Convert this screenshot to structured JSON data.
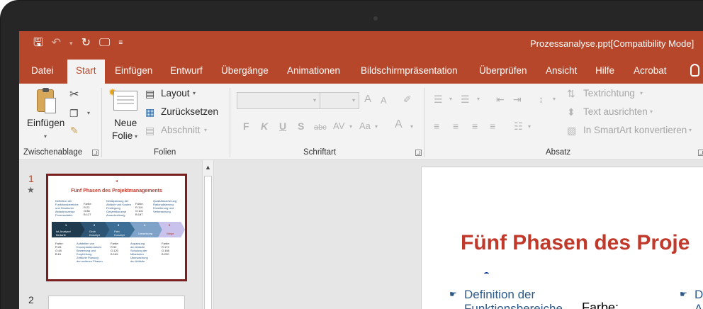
{
  "window": {
    "title": "Prozessanalyse.ppt[Compatibility Mode]"
  },
  "tabs": [
    "Datei",
    "Start",
    "Einfügen",
    "Entwurf",
    "Übergänge",
    "Animationen",
    "Bildschirmpräsentation",
    "Überprüfen",
    "Ansicht",
    "Hilfe",
    "Acrobat"
  ],
  "active_tab": "Start",
  "ribbon": {
    "clipboard": {
      "paste_label": "Einfügen",
      "group_label": "Zwischenablage"
    },
    "slides": {
      "new_slide_line1": "Neue",
      "new_slide_line2": "Folie",
      "layout_label": "Layout",
      "reset_label": "Zurücksetzen",
      "section_label": "Abschnitt",
      "group_label": "Folien"
    },
    "font": {
      "group_label": "Schriftart",
      "bold": "F",
      "italic": "K",
      "underline": "U",
      "shadow": "S",
      "strike": "abc",
      "spacing": "AV",
      "case": "Aa",
      "color": "A",
      "grow": "A",
      "shrink": "A"
    },
    "paragraph": {
      "group_label": "Absatz",
      "text_direction": "Textrichtung",
      "align_text": "Text ausrichten",
      "smartart": "In SmartArt konvertieren"
    }
  },
  "thumbnails": {
    "slide1_number": "1",
    "slide2_number": "2",
    "slide1": {
      "title": "Fünf Phasen des Projektmanagements",
      "col1": "Definition der\nFunktionsbereiche\nund Strukturen\nAblaufprozesse\nProzessdaten",
      "col1b": "Farbe:\nR:22\nG:86\nB:127",
      "col2": "Detailplanung der\nAbläufe und Kosten\nFestlegung\nGesamtkonzept\nAusschreibung",
      "col2b": "Farbe:\nR:119\nG:101\nB:187",
      "col3": "Qualitätssicherung\nRationalisierung\nErweiterung und\nVerbesserung",
      "chevrons": [
        "1",
        "2",
        "3",
        "4",
        "5"
      ],
      "chev_labels": [
        "Ist-Analyse/\nBedarfe",
        "Grob\nKonzept",
        "Fein\nKonzept",
        "Umsetzung",
        "Wege"
      ],
      "bottom1": "Farbe:\nR:26\nG:48\nB:61",
      "bottom2": "Aufstellen von\nKonzeptalternativen\nBewertung und\nEmpfehlung\nZeitliche Planung\nder weiteren Phasen",
      "bottom3": "Farbe:\nR:92\nG:120\nB:165",
      "bottom4": "Anpassung\nder Abläufe\nSchulung der\nMitarbeiter\nÜberwachung\nder Abläufe",
      "bottom5": "Farbe:\nR:172\nG:166\nB:230"
    }
  },
  "slide": {
    "title": "Fünf Phasen des Proje",
    "bullet1_line1": "Definition der",
    "bullet1_line2": "Funktionsbereiche",
    "farbe": "Farbe:",
    "bullet2_line1": "D",
    "bullet2_line2": "A"
  },
  "colors": {
    "accent": "#b7472a",
    "title_red": "#c0392b",
    "bullet_blue": "#2e5a88",
    "chevron_dark": "#1f3a4d",
    "chevron_mid": "#3d6e95",
    "chevron_light": "#7fa3c8",
    "chevron_last": "#c9c2ec"
  }
}
